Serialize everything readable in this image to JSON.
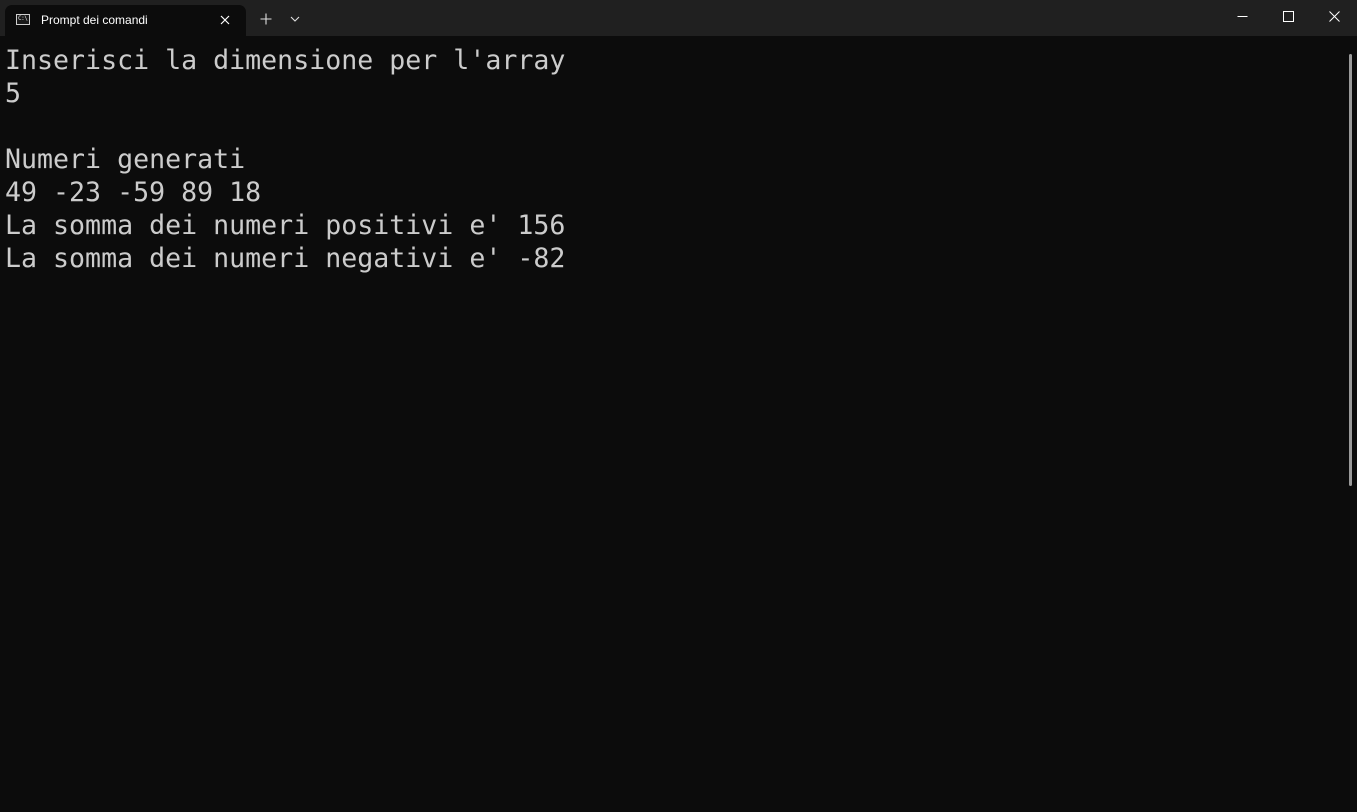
{
  "window": {
    "tab_title": "Prompt dei comandi",
    "tab_icon": "cmd-icon",
    "tab_icon_text": "C:\\",
    "new_tab_symbol": "+",
    "colors": {
      "titlebar": "#202020",
      "background": "#0c0c0c",
      "text": "#cccccc"
    }
  },
  "terminal": {
    "lines": [
      "Inserisci la dimensione per l'array",
      "5",
      "",
      "Numeri generati",
      "49 -23 -59 89 18",
      "La somma dei numeri positivi e' 156",
      "La somma dei numeri negativi e' -82"
    ]
  }
}
